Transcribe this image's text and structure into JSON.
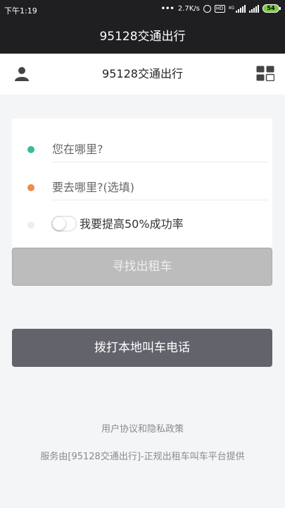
{
  "status_bar": {
    "time": "下午1:19",
    "speed": "2.7K/s",
    "hd": "HD",
    "network": "4G",
    "battery": "54"
  },
  "app_title": "95128交通出行",
  "header": {
    "title": "95128交通出行",
    "icons": [
      "user-icon",
      "grid-icon"
    ]
  },
  "form": {
    "origin_placeholder": "您在哪里?",
    "destination_placeholder": "要去哪里?(选填)",
    "boost_label": "我要提高50%成功率",
    "boost_enabled": false,
    "dot_colors": {
      "origin": "#3bb99a",
      "destination": "#ef8a4c",
      "boost": "#eeeeee"
    }
  },
  "buttons": {
    "find_taxi": "寻找出租车",
    "call_local": "拨打本地叫车电话"
  },
  "footer": {
    "agreement_link": "用户协议和隐私政策",
    "provider_note": "服务由[95128交通出行]-正规出租车叫车平台提供"
  }
}
